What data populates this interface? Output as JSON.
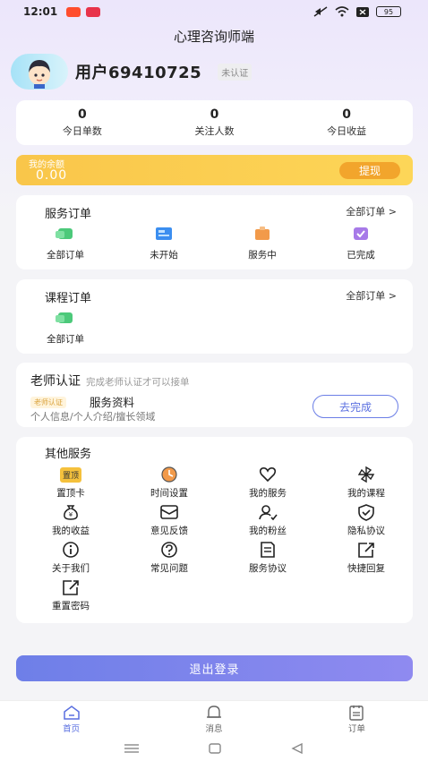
{
  "status_bar": {
    "time": "12:01",
    "battery": "95"
  },
  "header": {
    "title": "心理咨询师端"
  },
  "profile": {
    "username": "用户69410725",
    "verify_status": "未认证"
  },
  "stats": [
    {
      "value": "0",
      "label": "今日单数"
    },
    {
      "value": "0",
      "label": "关注人数"
    },
    {
      "value": "0",
      "label": "今日收益"
    }
  ],
  "balance": {
    "label": "我的余额",
    "value": "0.00",
    "button": "提现"
  },
  "service_orders": {
    "title": "服务订单",
    "more": "全部订单 >",
    "items": [
      {
        "label": "全部订单",
        "icon": "all-orders-icon",
        "color": "#4cc97a"
      },
      {
        "label": "未开始",
        "icon": "not-started-icon",
        "color": "#3b8ef0"
      },
      {
        "label": "服务中",
        "icon": "in-service-icon",
        "color": "#f29a4a"
      },
      {
        "label": "已完成",
        "icon": "completed-icon",
        "color": "#a77ae8"
      }
    ]
  },
  "course_orders": {
    "title": "课程订单",
    "more": "全部订单 >",
    "items": [
      {
        "label": "全部订单",
        "icon": "all-orders-icon",
        "color": "#4cc97a"
      }
    ]
  },
  "teacher_cert": {
    "title": "老师认证",
    "hint": "完成老师认证才可以接单",
    "tag": "老师认证",
    "name": "服务资料",
    "desc": "个人信息/个人介绍/擅长领域",
    "button": "去完成"
  },
  "other_services": {
    "title": "其他服务",
    "pin_badge": "置顶",
    "items": [
      {
        "label": "置顶卡",
        "icon": "pin-card-icon"
      },
      {
        "label": "时间设置",
        "icon": "clock-icon"
      },
      {
        "label": "我的服务",
        "icon": "heart-service-icon"
      },
      {
        "label": "我的课程",
        "icon": "pinwheel-icon"
      },
      {
        "label": "我的收益",
        "icon": "money-bag-icon"
      },
      {
        "label": "意见反馈",
        "icon": "feedback-icon"
      },
      {
        "label": "我的粉丝",
        "icon": "fans-icon"
      },
      {
        "label": "隐私协议",
        "icon": "shield-icon"
      },
      {
        "label": "关于我们",
        "icon": "info-icon"
      },
      {
        "label": "常见问题",
        "icon": "question-icon"
      },
      {
        "label": "服务协议",
        "icon": "document-icon"
      },
      {
        "label": "快捷回复",
        "icon": "quick-reply-icon"
      },
      {
        "label": "重置密码",
        "icon": "reset-password-icon"
      }
    ]
  },
  "logout": {
    "label": "退出登录"
  },
  "tabbar": [
    {
      "label": "首页",
      "icon": "home-icon",
      "active": true
    },
    {
      "label": "消息",
      "icon": "bell-icon",
      "active": false
    },
    {
      "label": "订单",
      "icon": "order-list-icon",
      "active": false
    }
  ]
}
